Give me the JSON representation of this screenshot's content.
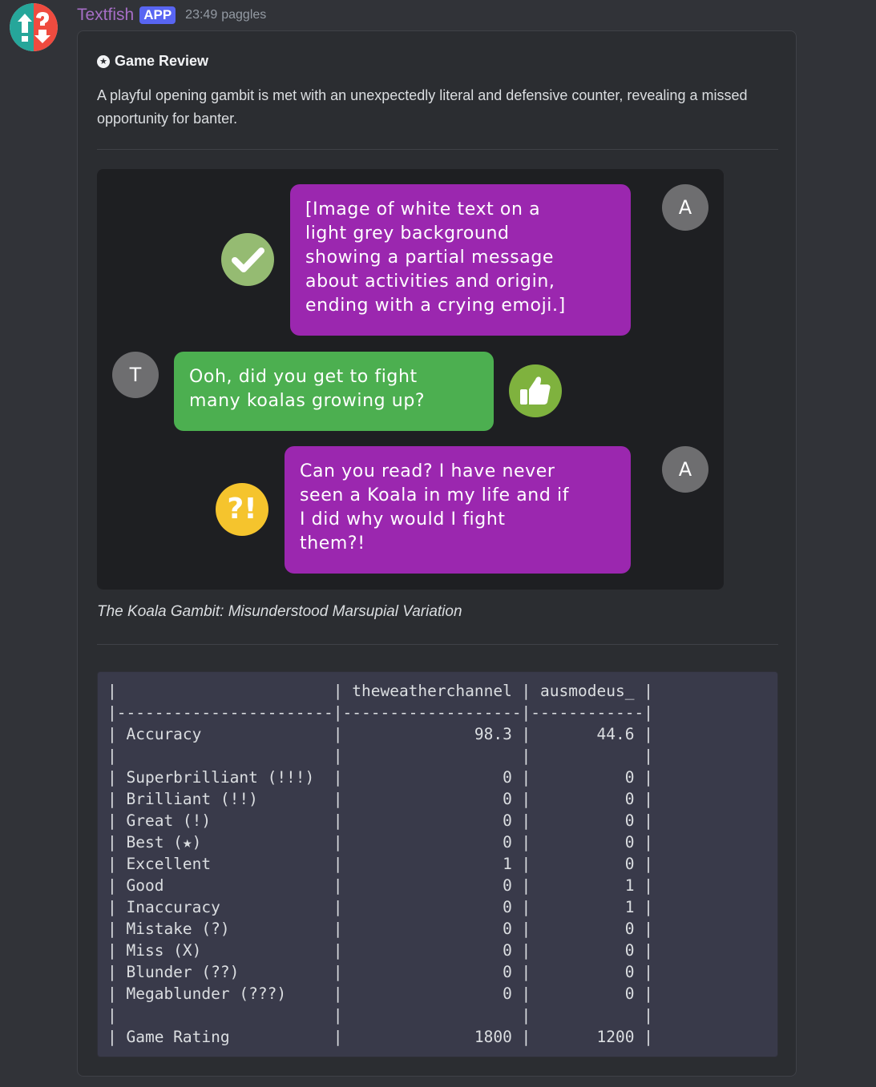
{
  "message": {
    "author": "Textfish",
    "app_badge": "APP",
    "timestamp": "23:49",
    "mention": "paggles"
  },
  "embed": {
    "title": "Game Review",
    "title_icon": "star-circle-icon",
    "description": "A playful opening gambit is met with an unexpectedly literal and defensive counter, revealing a missed opportunity for banter.",
    "caption": "The Koala Gambit: Misunderstood Marsupial Variation"
  },
  "chat": {
    "messages": [
      {
        "sender": "A",
        "text_lines": [
          "[Image of white text on a",
          "light grey background",
          "showing a partial message",
          "about activities and origin,",
          "ending with a crying emoji.]"
        ],
        "badge_icon": "checkmark-icon"
      },
      {
        "sender": "T",
        "text_lines": [
          "Ooh, did you get to fight",
          "many koalas growing up?"
        ],
        "badge_icon": "thumbs-up-icon"
      },
      {
        "sender": "A",
        "text_lines": [
          "Can you read? I have never",
          "seen a Koala in my life and if",
          "I did why would I fight",
          "them?!"
        ],
        "badge_icon": "interesting-icon",
        "badge_text": "?!"
      }
    ],
    "colors": {
      "opponent_bubble": "#9b27af",
      "player_bubble": "#4caf50",
      "good_badge": "#95bb72",
      "great_badge": "#7fb23e",
      "interesting_badge": "#f5c42d"
    }
  },
  "stats_table": {
    "lines": [
      "|                       | theweatherchannel | ausmodeus_ |",
      "|-----------------------|-------------------|------------|",
      "| Accuracy              |              98.3 |       44.6 |",
      "|                       |                   |            |",
      "| Superbrilliant (!!!)  |                 0 |          0 |",
      "| Brilliant (!!)        |                 0 |          0 |",
      "| Great (!)             |                 0 |          0 |",
      "| Best (★)              |                 0 |          0 |",
      "| Excellent             |                 1 |          0 |",
      "| Good                  |                 0 |          1 |",
      "| Inaccuracy            |                 0 |          1 |",
      "| Mistake (?)           |                 0 |          0 |",
      "| Miss (X)              |                 0 |          0 |",
      "| Blunder (??)          |                 0 |          0 |",
      "| Megablunder (???)     |                 0 |          0 |",
      "|                       |                   |            |",
      "| Game Rating           |              1800 |       1200 |"
    ]
  }
}
